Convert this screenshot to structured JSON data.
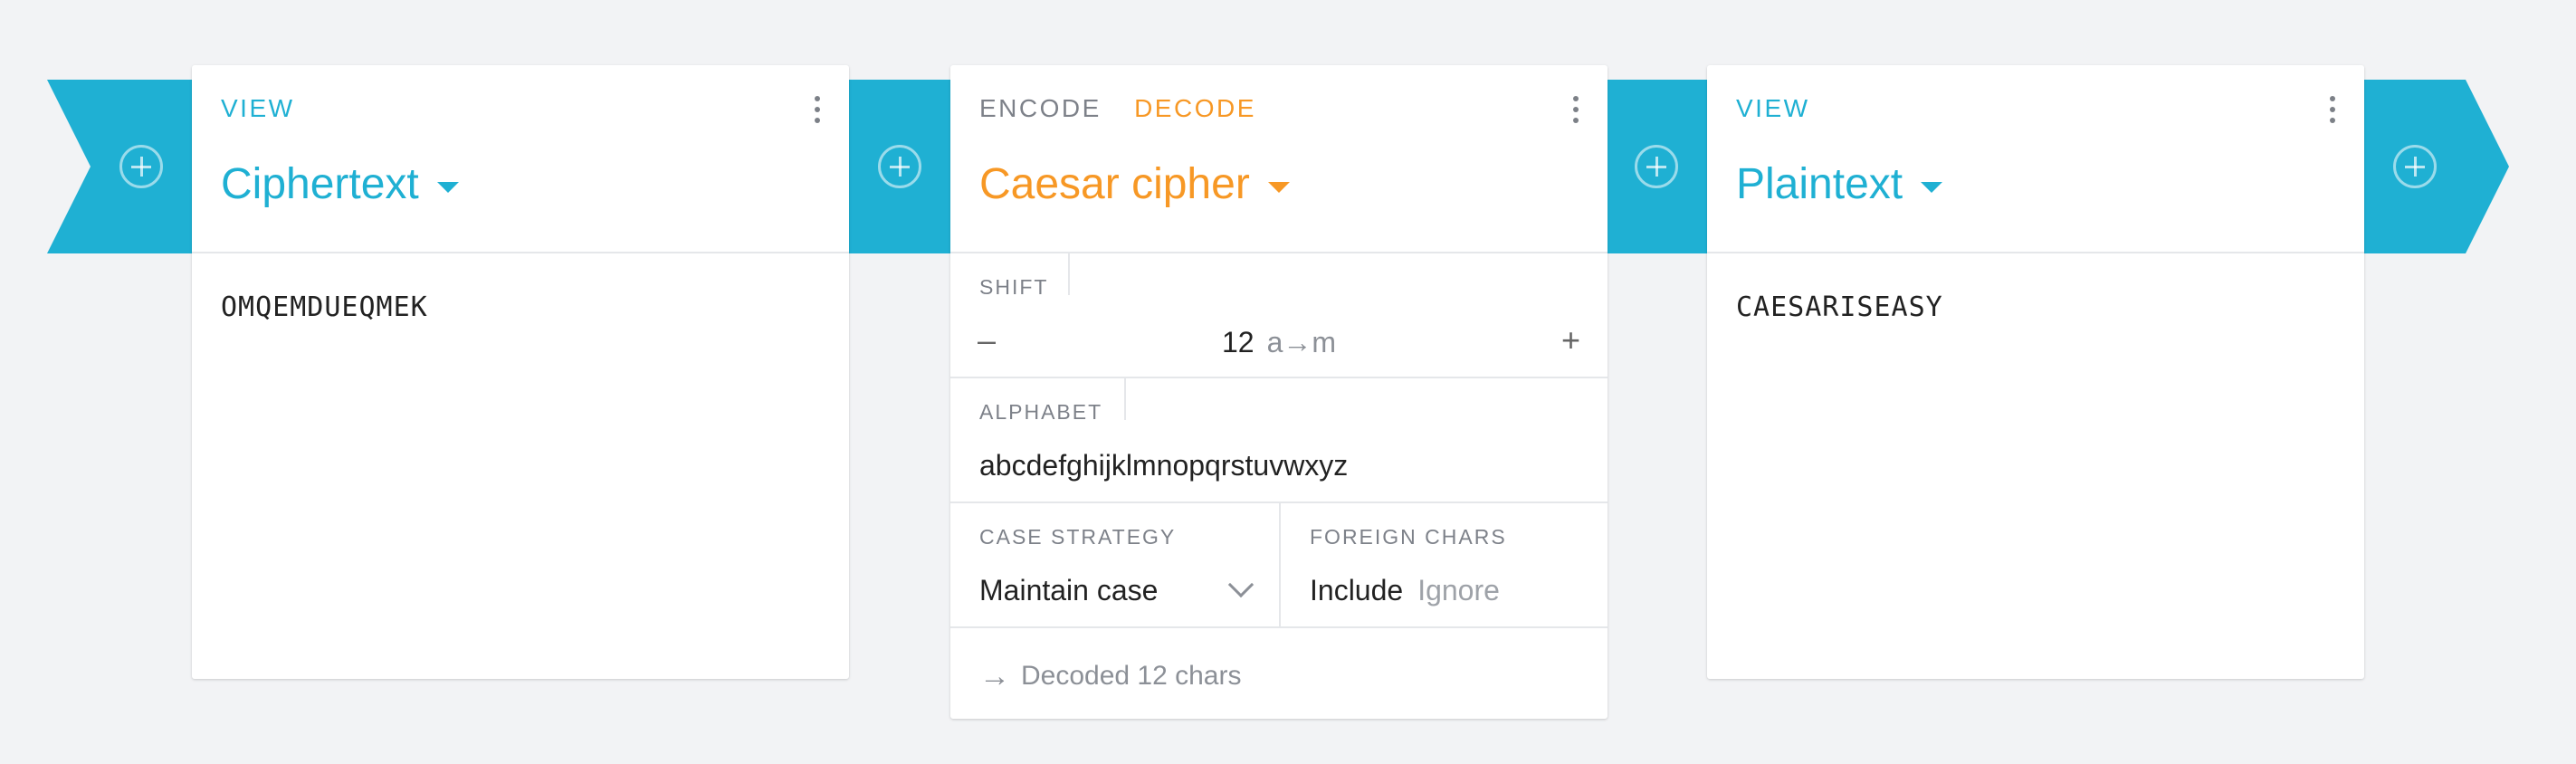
{
  "colors": {
    "accent_teal": "#1fb0d3",
    "accent_orange": "#f79825",
    "background": "#f2f3f5"
  },
  "cards": {
    "left": {
      "mode": "VIEW",
      "title": "Ciphertext",
      "content": "OMQEMDUEQMEK"
    },
    "middle": {
      "mode_encode": "ENCODE",
      "mode_decode": "DECODE",
      "active_mode": "DECODE",
      "title": "Caesar cipher",
      "shift": {
        "label": "SHIFT",
        "minus": "–",
        "value": "12",
        "mapping": "a→m",
        "plus": "+"
      },
      "alphabet": {
        "label": "ALPHABET",
        "value": "abcdefghijklmnopqrstuvwxyz"
      },
      "case_strategy": {
        "label": "CASE STRATEGY",
        "value": "Maintain case"
      },
      "foreign_chars": {
        "label": "FOREIGN CHARS",
        "option_active": "Include",
        "option_inactive": "Ignore"
      },
      "status": {
        "icon": "arrow-right-icon",
        "text": "Decoded 12 chars"
      }
    },
    "right": {
      "mode": "VIEW",
      "title": "Plaintext",
      "content": "CAESARISEASY"
    }
  }
}
